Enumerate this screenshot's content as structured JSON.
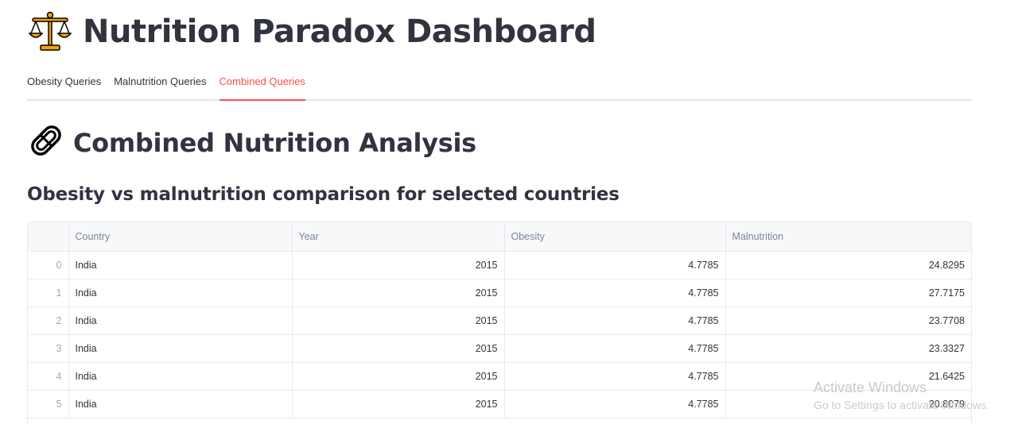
{
  "app": {
    "title": "Nutrition Paradox Dashboard",
    "title_icon": "balance-scale-icon"
  },
  "tabs": [
    {
      "label": "Obesity Queries",
      "active": false
    },
    {
      "label": "Malnutrition Queries",
      "active": false
    },
    {
      "label": "Combined Queries",
      "active": true
    }
  ],
  "section": {
    "title": "Combined Nutrition Analysis",
    "icon": "pill-icon",
    "subheader": "Obesity vs malnutrition comparison for selected countries"
  },
  "table": {
    "columns": [
      "",
      "Country",
      "Year",
      "Obesity",
      "Malnutrition"
    ],
    "rows": [
      {
        "index": "0",
        "country": "India",
        "year": "2015",
        "obesity": "4.7785",
        "malnutrition": "24.8295"
      },
      {
        "index": "1",
        "country": "India",
        "year": "2015",
        "obesity": "4.7785",
        "malnutrition": "27.7175"
      },
      {
        "index": "2",
        "country": "India",
        "year": "2015",
        "obesity": "4.7785",
        "malnutrition": "23.7708"
      },
      {
        "index": "3",
        "country": "India",
        "year": "2015",
        "obesity": "4.7785",
        "malnutrition": "23.3327"
      },
      {
        "index": "4",
        "country": "India",
        "year": "2015",
        "obesity": "4.7785",
        "malnutrition": "21.6425"
      },
      {
        "index": "5",
        "country": "India",
        "year": "2015",
        "obesity": "4.7785",
        "malnutrition": "20.8079"
      }
    ]
  },
  "watermark": {
    "line1": "Activate Windows",
    "line2": "Go to Settings to activate Windows."
  },
  "colors": {
    "accent": "#ff4b4b",
    "text": "#31333f",
    "muted": "#808495"
  }
}
